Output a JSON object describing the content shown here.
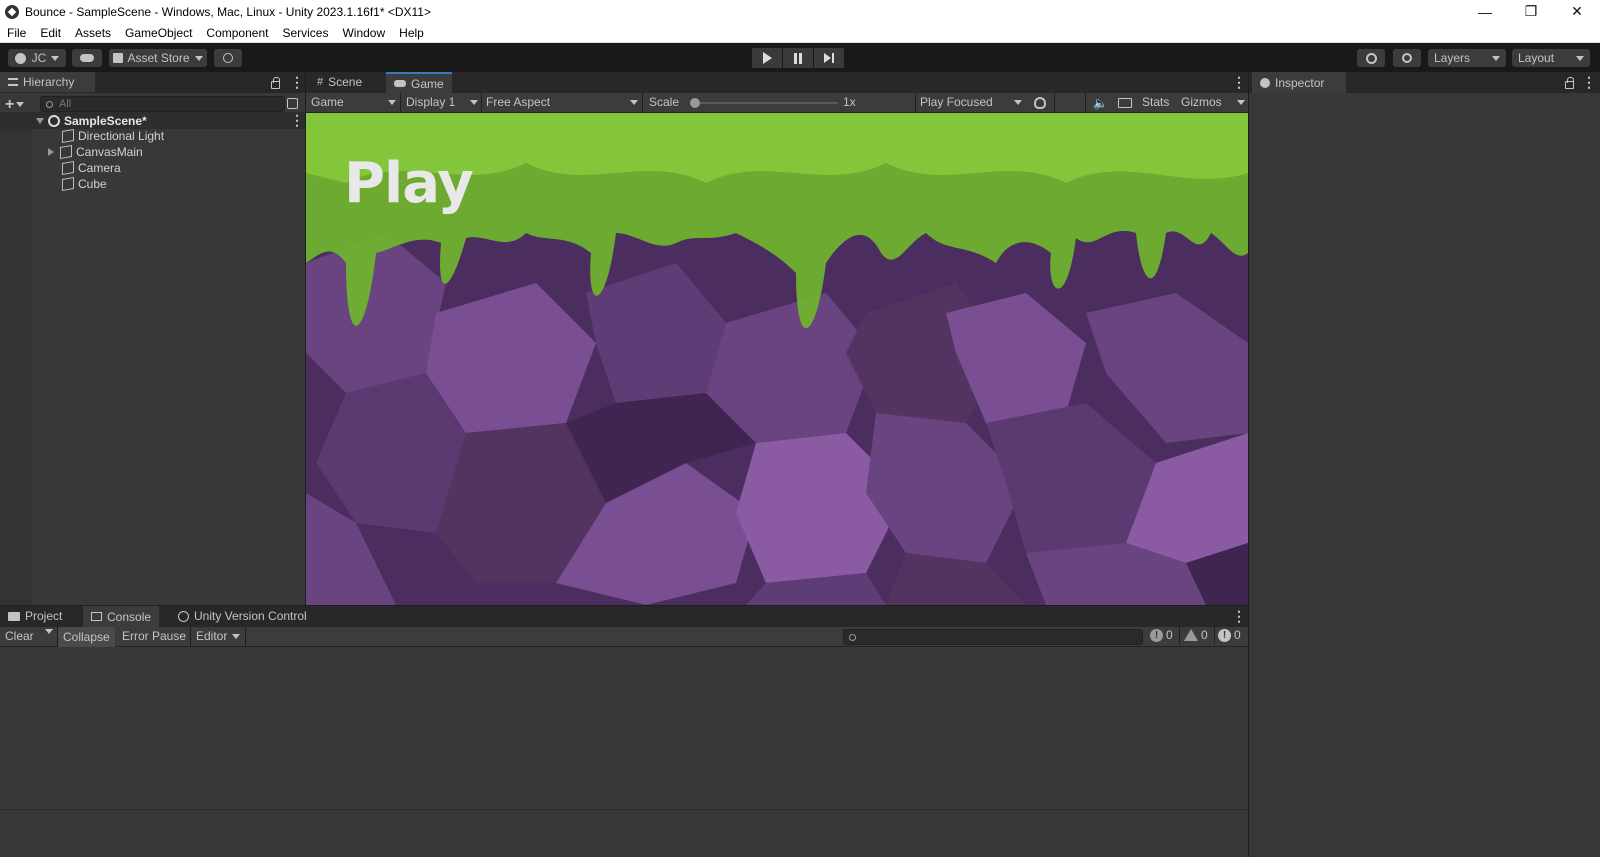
{
  "window": {
    "title": "Bounce - SampleScene - Windows, Mac, Linux - Unity 2023.1.16f1* <DX11>"
  },
  "menu": [
    "File",
    "Edit",
    "Assets",
    "GameObject",
    "Component",
    "Services",
    "Window",
    "Help"
  ],
  "toolbar": {
    "account": "JC",
    "asset_store": "Asset Store",
    "layers": "Layers",
    "layout": "Layout"
  },
  "hierarchy": {
    "tab": "Hierarchy",
    "search_placeholder": "All",
    "scene": "SampleScene*",
    "items": [
      "Directional Light",
      "CanvasMain",
      "Camera",
      "Cube"
    ]
  },
  "game_view": {
    "tabs": [
      "Scene",
      "Game"
    ],
    "active_tab": "Game",
    "mode": "Game",
    "display": "Display 1",
    "aspect": "Free Aspect",
    "scale_label": "Scale",
    "scale_value": "1x",
    "scale_fraction": 0.0,
    "play_mode": "Play Focused",
    "stats": "Stats",
    "gizmos": "Gizmos",
    "scene_text": "Play",
    "colors": {
      "slime": "#6fb52e",
      "rock": "#5a3870",
      "accent": "#3a79bb"
    }
  },
  "inspector": {
    "tab": "Inspector"
  },
  "console": {
    "tabs": [
      "Project",
      "Console",
      "Unity Version Control"
    ],
    "active_tab": "Console",
    "clear": "Clear",
    "collapse": "Collapse",
    "error_pause": "Error Pause",
    "editor": "Editor",
    "log_count": "0",
    "warning_count": "0",
    "error_count": "0"
  }
}
